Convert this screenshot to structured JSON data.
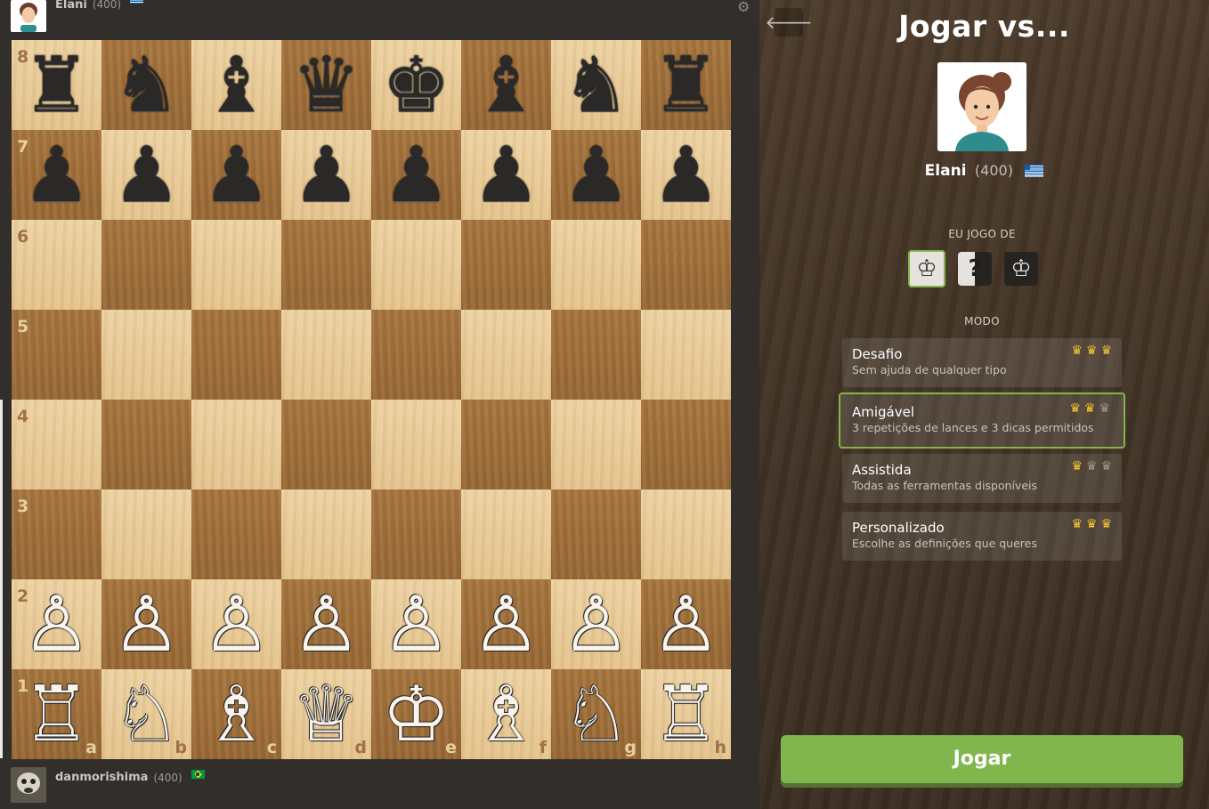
{
  "top_player": {
    "name": "Elani",
    "rating": "(400)",
    "flag": "greece-flag"
  },
  "bottom_player": {
    "name": "danmorishima",
    "rating": "(400)",
    "flag": "brazil-flag"
  },
  "board": {
    "ranks": [
      "8",
      "7",
      "6",
      "5",
      "4",
      "3",
      "2",
      "1"
    ],
    "files": [
      "a",
      "b",
      "c",
      "d",
      "e",
      "f",
      "g",
      "h"
    ],
    "pieces": {
      "8": [
        "♜",
        "♞",
        "♝",
        "♛",
        "♚",
        "♝",
        "♞",
        "♜"
      ],
      "7": [
        "♟",
        "♟",
        "♟",
        "♟",
        "♟",
        "♟",
        "♟",
        "♟"
      ],
      "2": [
        "♙",
        "♙",
        "♙",
        "♙",
        "♙",
        "♙",
        "♙",
        "♙"
      ],
      "1": [
        "♖",
        "♘",
        "♗",
        "♕",
        "♔",
        "♗",
        "♘",
        "♖"
      ]
    },
    "light_color": "#e8c996",
    "dark_color": "#a26f3a"
  },
  "panel": {
    "title": "Jogar vs...",
    "opponent_name": "Elani",
    "opponent_rating": "(400)",
    "color_label": "EU JOGO DE",
    "color_options": [
      "white",
      "random",
      "black"
    ],
    "selected_color": "white",
    "mode_label": "MODO",
    "modes": [
      {
        "title": "Desafio",
        "desc": "Sem ajuda de qualquer tipo",
        "crowns": 3
      },
      {
        "title": "Amigável",
        "desc": "3 repetições de lances e 3 dicas permitidos",
        "crowns": 2
      },
      {
        "title": "Assistida",
        "desc": "Todas as ferramentas disponíveis",
        "crowns": 1
      },
      {
        "title": "Personalizado",
        "desc": "Escolhe as definições que queres",
        "crowns": 3
      }
    ],
    "selected_mode": "Amigável",
    "play_label": "Jogar",
    "accent_color": "#81b64c"
  }
}
